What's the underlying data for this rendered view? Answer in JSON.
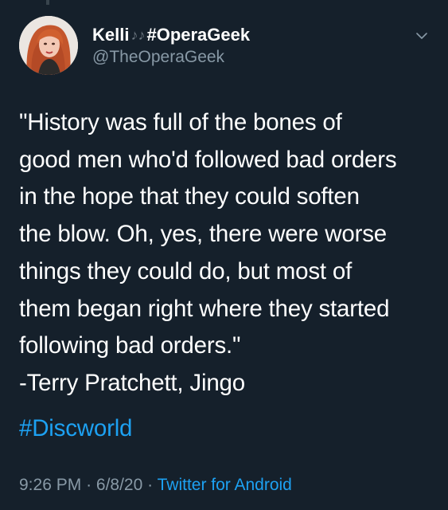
{
  "tweet": {
    "author": {
      "name_prefix": "Kelli",
      "name_emoji": "♪♪",
      "name_suffix": "#OperaGeek",
      "handle": "@TheOperaGeek"
    },
    "body_lines": [
      "\"History was full of the bones of",
      "good men who'd followed bad orders",
      "in the hope that they could soften",
      "the blow. Oh, yes, there were worse",
      "things they could do, but most of",
      "them began right where they started",
      "following bad orders.\"",
      "-Terry Pratchett, Jingo"
    ],
    "hashtag": "#Discworld",
    "time": "9:26 PM",
    "separator": "·",
    "date": "6/8/20",
    "source": "Twitter for Android"
  },
  "icons": {
    "more": "chevron-down-icon",
    "avatar": "avatar"
  },
  "colors": {
    "background": "#15202b",
    "text": "#ffffff",
    "secondary": "#8899a6",
    "link": "#1da1f2"
  }
}
